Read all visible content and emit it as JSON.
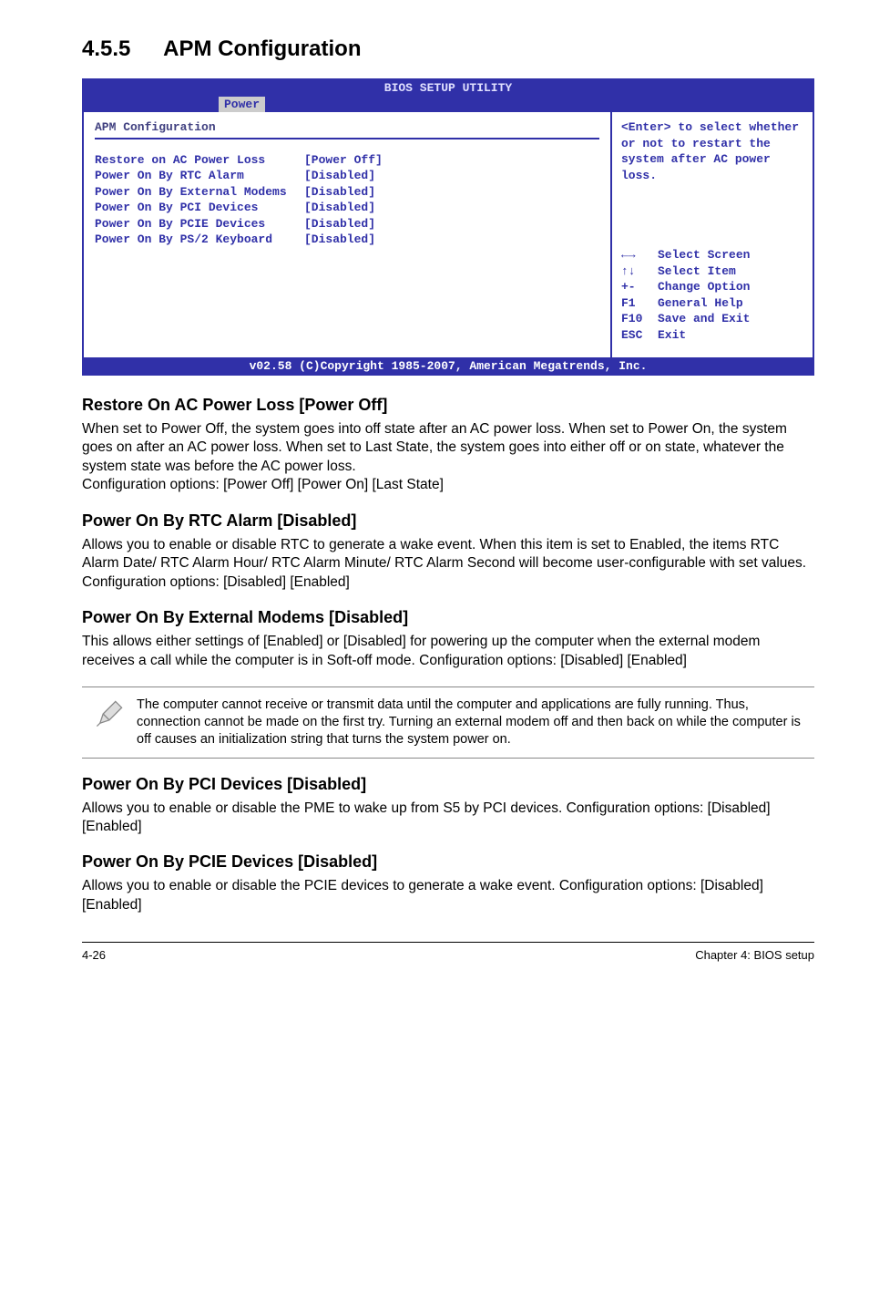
{
  "section": {
    "number": "4.5.5",
    "title": "APM Configuration"
  },
  "bios": {
    "header": "BIOS SETUP UTILITY",
    "tab": "Power",
    "panel_title": "APM Configuration",
    "items": [
      {
        "label": "Restore on AC Power Loss",
        "value": "[Power Off]"
      },
      {
        "label": "Power On By RTC Alarm",
        "value": "[Disabled]"
      },
      {
        "label": "Power On By External Modems",
        "value": "[Disabled]"
      },
      {
        "label": "Power On By PCI Devices",
        "value": "[Disabled]"
      },
      {
        "label": "Power On By PCIE Devices",
        "value": "[Disabled]"
      },
      {
        "label": "Power On By PS/2 Keyboard",
        "value": "[Disabled]"
      }
    ],
    "help": "<Enter> to select whether or not to restart the system after AC power loss.",
    "keys": [
      {
        "sym": "←→",
        "desc": "Select Screen"
      },
      {
        "sym": "↑↓",
        "desc": "Select Item"
      },
      {
        "sym": "+-",
        "desc": "Change Option"
      },
      {
        "sym": "F1",
        "desc": "General Help"
      },
      {
        "sym": "F10",
        "desc": "Save and Exit"
      },
      {
        "sym": "ESC",
        "desc": "Exit"
      }
    ],
    "footer": "v02.58 (C)Copyright 1985-2007, American Megatrends, Inc."
  },
  "sections": [
    {
      "heading": "Restore On AC Power Loss [Power Off]",
      "body": "When set to Power Off, the system goes into off state after an AC power loss. When set to Power On, the system goes on after an AC power loss. When set to Last State, the system goes into either off or on state, whatever the system state was before the AC power loss.\nConfiguration options: [Power Off] [Power On] [Last State]"
    },
    {
      "heading": "Power On By RTC Alarm [Disabled]",
      "body": "Allows you to enable or disable RTC to generate a wake event. When this item is set to Enabled, the items RTC Alarm Date/ RTC Alarm Hour/ RTC Alarm Minute/ RTC Alarm Second will become user-configurable with set values.\nConfiguration options: [Disabled] [Enabled]"
    },
    {
      "heading": "Power On By External Modems [Disabled]",
      "body": "This allows either settings of [Enabled] or [Disabled] for powering up the computer when the external modem receives a call while the computer is in Soft-off mode. Configuration options: [Disabled] [Enabled]"
    }
  ],
  "note": "The computer cannot receive or transmit data until the computer and applications are fully running. Thus, connection cannot be made on the first try. Turning an external modem off and then back on while the computer is off causes an initialization string that turns the system power on.",
  "sections2": [
    {
      "heading": "Power On By PCI Devices [Disabled]",
      "body": "Allows you to enable or disable the PME to wake up from S5 by PCI devices. Configuration options: [Disabled] [Enabled]"
    },
    {
      "heading": "Power On By PCIE Devices [Disabled]",
      "body": "Allows you to enable or disable the PCIE devices to generate a wake event. Configuration options: [Disabled] [Enabled]"
    }
  ],
  "footer": {
    "left": "4-26",
    "right": "Chapter 4: BIOS setup"
  }
}
